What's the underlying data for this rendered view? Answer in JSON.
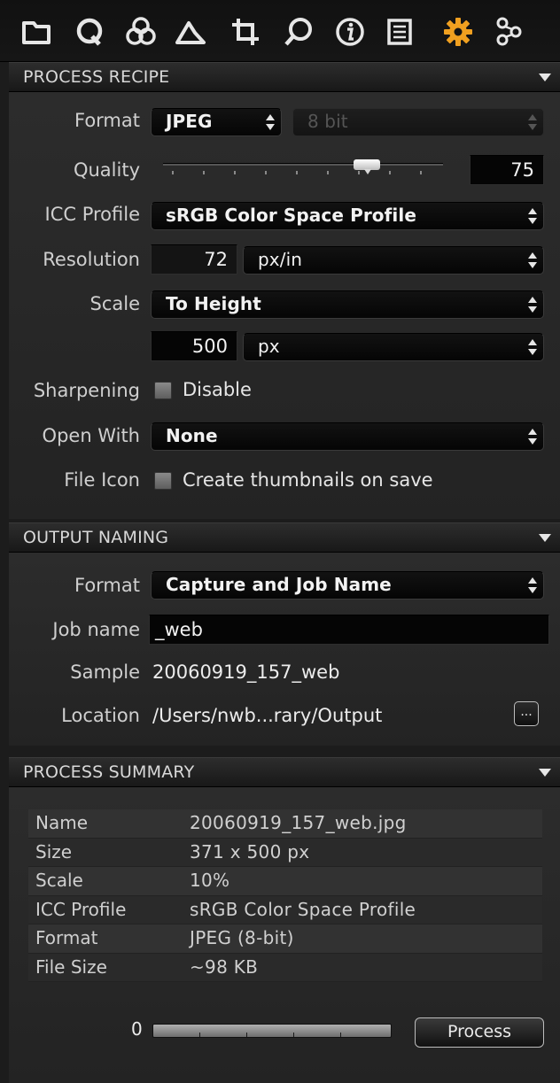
{
  "toolbar": {
    "icons": [
      "folder-icon",
      "capture-q-icon",
      "color-circles-icon",
      "exposure-icon",
      "crop-icon",
      "focus-loupe-icon",
      "info-icon",
      "metadata-list-icon",
      "process-gear-icon",
      "adjustments-icon"
    ],
    "active": "process-gear-icon",
    "accent_color": "#f0a020"
  },
  "process_recipe": {
    "header": "PROCESS RECIPE",
    "format_label": "Format",
    "format_value": "JPEG",
    "bitdepth_value": "8 bit",
    "quality_label": "Quality",
    "quality_value": "75",
    "quality_fraction": 0.75,
    "icc_label": "ICC Profile",
    "icc_value": "sRGB Color Space Profile",
    "resolution_label": "Resolution",
    "resolution_value": "72",
    "resolution_unit": "px/in",
    "scale_label": "Scale",
    "scale_value": "To Height",
    "scale_amount": "500",
    "scale_unit": "px",
    "sharpening_label": "Sharpening",
    "sharpening_check": "Disable",
    "openwith_label": "Open With",
    "openwith_value": "None",
    "fileicon_label": "File Icon",
    "fileicon_check": "Create thumbnails on save"
  },
  "output_naming": {
    "header": "OUTPUT NAMING",
    "format_label": "Format",
    "format_value": "Capture and Job Name",
    "jobname_label": "Job name",
    "jobname_value": "_web",
    "sample_label": "Sample",
    "sample_value": "20060919_157_web",
    "location_label": "Location",
    "location_value": "/Users/nwb...rary/Output",
    "browse_label": "..."
  },
  "process_summary": {
    "header": "PROCESS SUMMARY",
    "rows": [
      {
        "key": "Name",
        "value": "20060919_157_web.jpg"
      },
      {
        "key": "Size",
        "value": "371 x 500 px"
      },
      {
        "key": "Scale",
        "value": "10%"
      },
      {
        "key": "ICC Profile",
        "value": "sRGB Color Space Profile"
      },
      {
        "key": "Format",
        "value": "JPEG (8-bit)"
      },
      {
        "key": "File Size",
        "value": "~98 KB"
      }
    ],
    "queue_count": "0",
    "process_label": "Process"
  }
}
